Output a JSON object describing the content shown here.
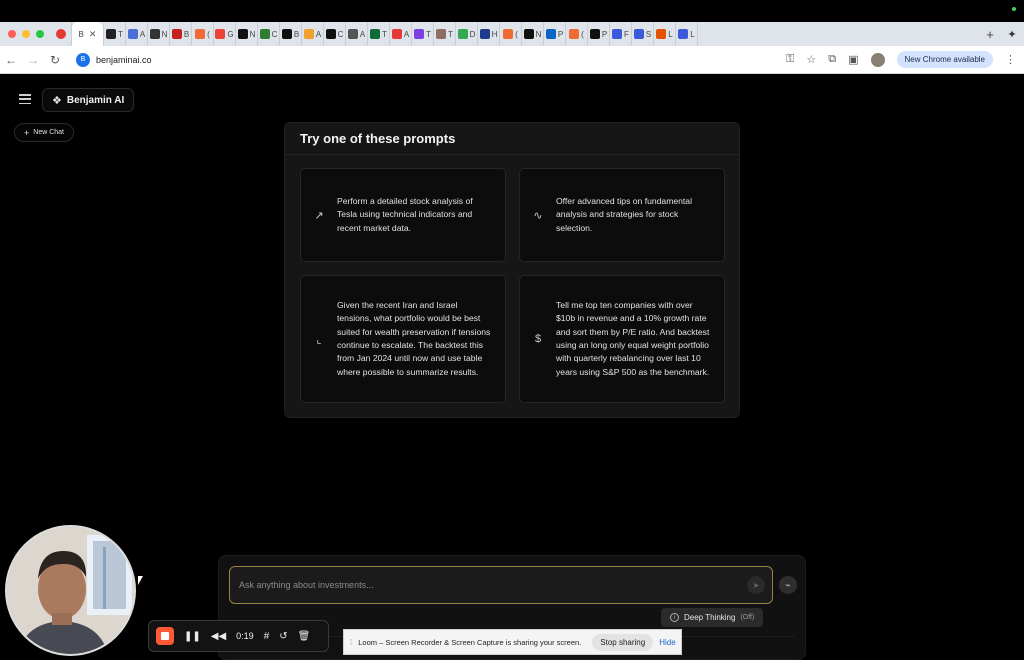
{
  "browser": {
    "active_tab_label": "B",
    "tabs": [
      {
        "label": "T",
        "color": "#222222"
      },
      {
        "label": "A",
        "color": "#4a6fd6"
      },
      {
        "label": "N",
        "color": "#333333"
      },
      {
        "label": "B",
        "color": "#c5221f"
      },
      {
        "label": "(",
        "color": "#f06a35"
      },
      {
        "label": "G",
        "color": "#ea4335"
      },
      {
        "label": "N",
        "color": "#111111"
      },
      {
        "label": "C",
        "color": "#2e7d32"
      },
      {
        "label": "B",
        "color": "#111111"
      },
      {
        "label": "A",
        "color": "#f0a030"
      },
      {
        "label": "C",
        "color": "#111111"
      },
      {
        "label": "A",
        "color": "#555555"
      },
      {
        "label": "T",
        "color": "#0f6b3a"
      },
      {
        "label": "A",
        "color": "#e53935"
      },
      {
        "label": "T",
        "color": "#7b3fe4"
      },
      {
        "label": "T",
        "color": "#8d6e63"
      },
      {
        "label": "D",
        "color": "#34a853"
      },
      {
        "label": "H",
        "color": "#1e3a8a"
      },
      {
        "label": "(",
        "color": "#f06a35"
      },
      {
        "label": "N",
        "color": "#111111"
      },
      {
        "label": "P",
        "color": "#0a66c2"
      },
      {
        "label": "(",
        "color": "#f06a35"
      },
      {
        "label": "P",
        "color": "#111111"
      },
      {
        "label": "F",
        "color": "#3b5bdb"
      },
      {
        "label": "S",
        "color": "#3b5bdb"
      },
      {
        "label": "L",
        "color": "#e65100"
      },
      {
        "label": "L",
        "color": "#3b5bdb"
      }
    ],
    "url": "benjaminai.co",
    "update_label": "New Chrome available"
  },
  "sidebar": {
    "brand_name": "Benjamin AI",
    "new_chat_label": "New Chat"
  },
  "prompts": {
    "title": "Try one of these prompts",
    "cards": [
      {
        "icon": "trending-up-icon",
        "glyph": "↗",
        "text": "Perform a detailed stock analysis of Tesla using technical indicators and recent market data."
      },
      {
        "icon": "activity-icon",
        "glyph": "∿",
        "text": "Offer advanced tips on fundamental analysis and strategies for stock selection."
      },
      {
        "icon": "line-chart-icon",
        "glyph": "⌞",
        "text": "Given the recent Iran and Israel tensions, what portfolio would be best suited for wealth preservation if tensions continue to escalate. The backtest this from Jan 2024 until now and use table where possible to summarize results."
      },
      {
        "icon": "dollar-icon",
        "glyph": "$",
        "text": "Tell me top ten companies with over $10b in revenue and a 10% growth rate and sort them by P/E ratio. And backtest using an long only equal weight portfolio with quarterly rebalancing over last 10 years using S&P 500 as the benchmark."
      }
    ]
  },
  "composer": {
    "placeholder": "Ask anything about investments...",
    "deep_thinking_label": "Deep Thinking",
    "deep_thinking_state": "(Off)"
  },
  "loom": {
    "time": "0:19",
    "share_message": "Loom – Screen Recorder & Screen Capture is sharing your screen.",
    "stop_label": "Stop sharing",
    "hide_label": "Hide"
  }
}
